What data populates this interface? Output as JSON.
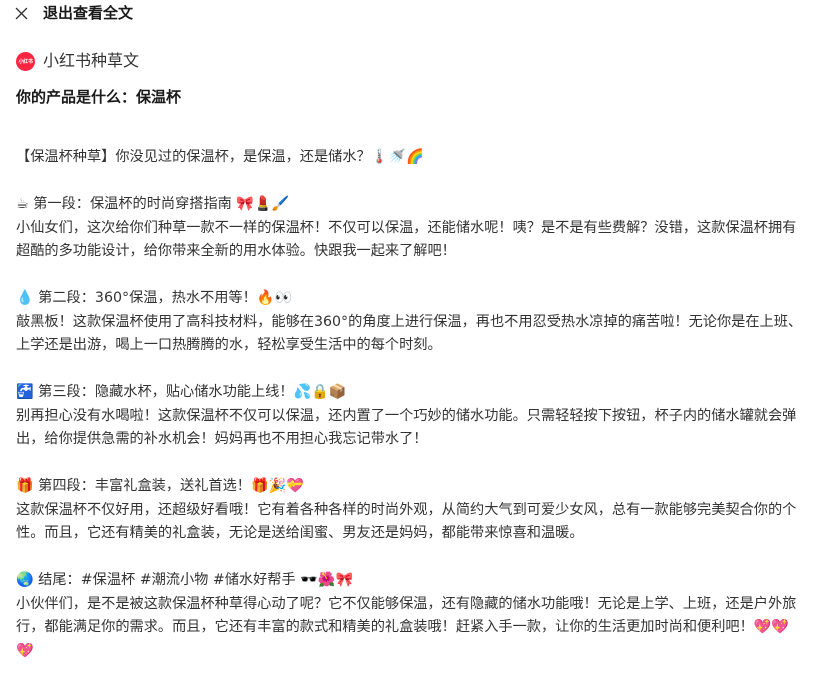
{
  "topbar": {
    "title": "退出查看全文"
  },
  "app": {
    "logo_text": "小红书",
    "name": "小红书种草文"
  },
  "question": "你的产品是什么：保温杯",
  "colors": {
    "brand": "#ff2442",
    "text": "#333333",
    "heading": "#1a1a1a"
  },
  "paragraphs": [
    {
      "heading": "【保温杯种草】你没见过的保温杯，是保温，还是储水？🌡️🚿🌈",
      "body": ""
    },
    {
      "heading": "☕ 第一段：保温杯的时尚穿搭指南 🎀💄🖌️",
      "body": "小仙女们，这次给你们种草一款不一样的保温杯！不仅可以保温，还能储水呢！咦？是不是有些费解？没错，这款保温杯拥有超酷的多功能设计，给你带来全新的用水体验。快跟我一起来了解吧！"
    },
    {
      "heading": "💧 第二段：360°保温，热水不用等！🔥👀",
      "body": "敲黑板！这款保温杯使用了高科技材料，能够在360°的角度上进行保温，再也不用忍受热水凉掉的痛苦啦！无论你是在上班、上学还是出游，喝上一口热腾腾的水，轻松享受生活中的每个时刻。"
    },
    {
      "heading": "🚰 第三段：隐藏水杯，贴心储水功能上线！💦🔒📦",
      "body": "别再担心没有水喝啦！这款保温杯不仅可以保温，还内置了一个巧妙的储水功能。只需轻轻按下按钮，杯子内的储水罐就会弹出，给你提供急需的补水机会！妈妈再也不用担心我忘记带水了！"
    },
    {
      "heading": "🎁 第四段：丰富礼盒装，送礼首选！🎁🎉💝",
      "body": "这款保温杯不仅好用，还超级好看哦！它有着各种各样的时尚外观，从简约大气到可爱少女风，总有一款能够完美契合你的个性。而且，它还有精美的礼盒装，无论是送给闺蜜、男友还是妈妈，都能带来惊喜和温暖。"
    },
    {
      "heading": "🌏 结尾：#保温杯 #潮流小物 #储水好帮手 🕶️🌺🎀",
      "body": "小伙伴们，是不是被这款保温杯种草得心动了呢？它不仅能够保温，还有隐藏的储水功能哦！无论是上学、上班，还是户外旅行，都能满足你的需求。而且，它还有丰富的款式和精美的礼盒装哦！赶紧入手一款，让你的生活更加时尚和便利吧！💖💖💖"
    }
  ]
}
